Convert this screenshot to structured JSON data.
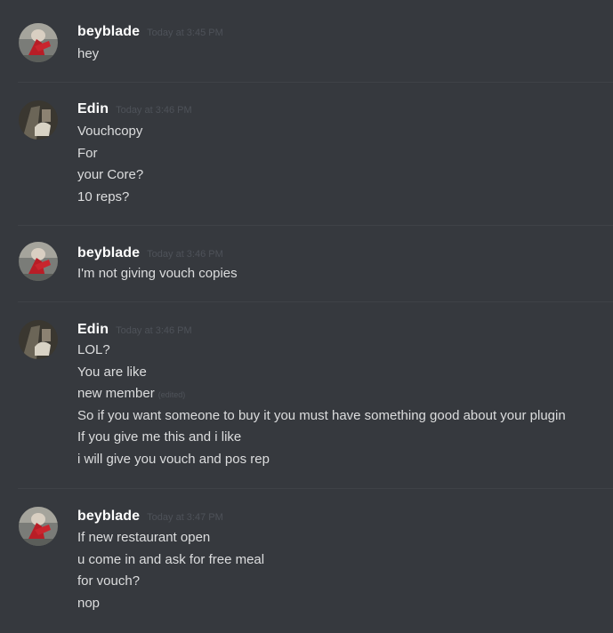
{
  "messages": [
    {
      "author": "beyblade",
      "timestamp": "Today at 3:45 PM",
      "avatar_icon": "beyblade-avatar-icon",
      "lines": [
        "hey"
      ]
    },
    {
      "author": "Edin",
      "timestamp": "Today at 3:46 PM",
      "avatar_icon": "edin-avatar-icon",
      "lines": [
        "Vouchcopy",
        "For",
        "your Core?",
        "10 reps?"
      ]
    },
    {
      "author": "beyblade",
      "timestamp": "Today at 3:46 PM",
      "avatar_icon": "beyblade-avatar-icon",
      "lines": [
        "I'm not giving vouch copies"
      ]
    },
    {
      "author": "Edin",
      "timestamp": "Today at 3:46 PM",
      "avatar_icon": "edin-avatar-icon",
      "lines": [
        "LOL?",
        "You are like",
        "new member",
        "So if you want someone to buy it you must have something good about your plugin",
        "If you give me this and i like",
        "i will give you vouch and pos rep"
      ],
      "edited_label": "(edited)"
    },
    {
      "author": "beyblade",
      "timestamp": "Today at 3:47 PM",
      "avatar_icon": "beyblade-avatar-icon",
      "lines": [
        "If new restaurant open",
        "u come in and ask for free meal",
        "for vouch?",
        "nop"
      ]
    }
  ],
  "colors": {
    "background": "#36393e",
    "username": "#ffffff",
    "message_text": "#dcddde",
    "timestamp": "#4e5259",
    "divider": "#3f4247"
  }
}
